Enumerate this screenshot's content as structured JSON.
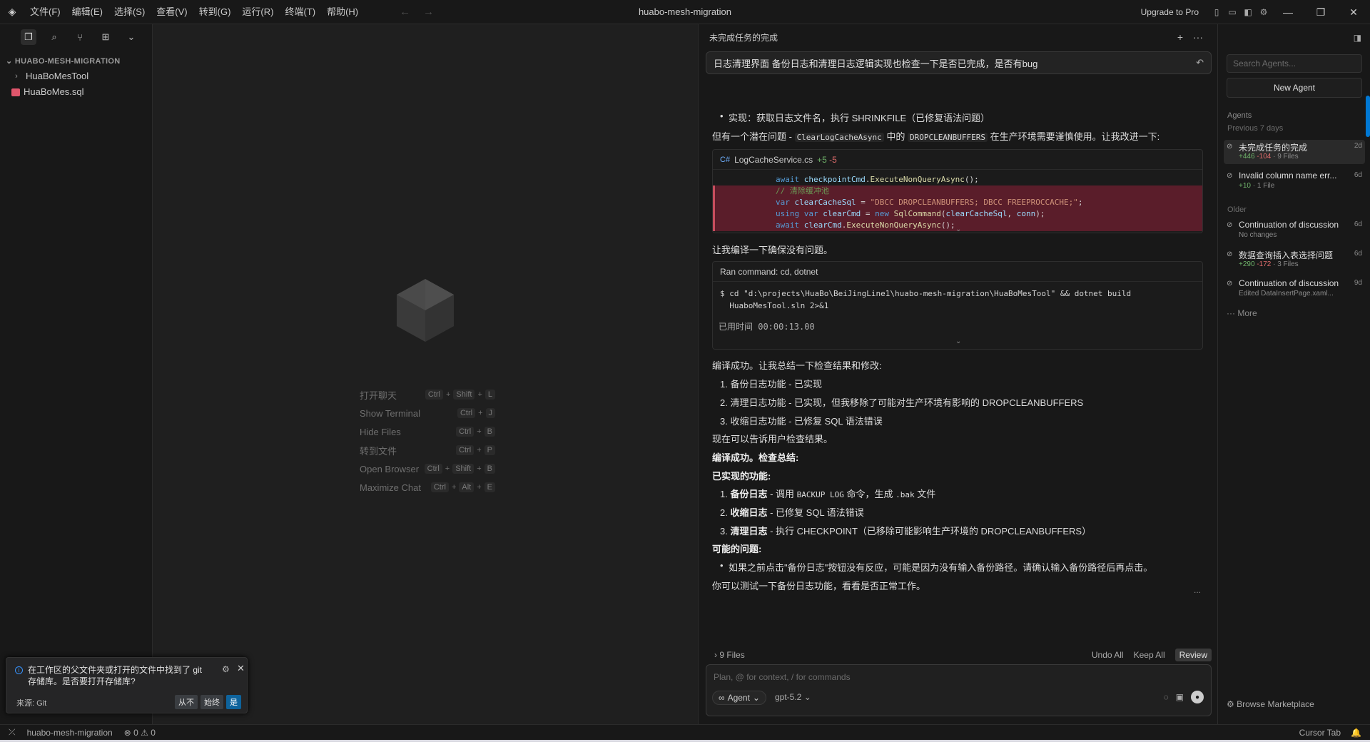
{
  "window": {
    "title": "huabo-mesh-migration",
    "upgrade": "Upgrade to Pro",
    "menu": [
      "文件(F)",
      "编辑(E)",
      "选择(S)",
      "查看(V)",
      "转到(G)",
      "运行(R)",
      "终端(T)",
      "帮助(H)"
    ]
  },
  "sidebar": {
    "project": "HUABO-MESH-MIGRATION",
    "items": [
      {
        "label": "HuaBoMesTool",
        "type": "folder"
      },
      {
        "label": "HuaBoMes.sql",
        "type": "file"
      }
    ]
  },
  "editor": {
    "shortcuts": [
      {
        "label": "打开聊天",
        "keys": [
          "Ctrl",
          "Shift",
          "L"
        ]
      },
      {
        "label": "Show Terminal",
        "keys": [
          "Ctrl",
          "J"
        ]
      },
      {
        "label": "Hide Files",
        "keys": [
          "Ctrl",
          "B"
        ]
      },
      {
        "label": "转到文件",
        "keys": [
          "Ctrl",
          "P"
        ]
      },
      {
        "label": "Open Browser",
        "keys": [
          "Ctrl",
          "Shift",
          "B"
        ]
      },
      {
        "label": "Maximize Chat",
        "keys": [
          "Ctrl",
          "Alt",
          "E"
        ]
      }
    ]
  },
  "notification": {
    "message": "在工作区的父文件夹或打开的文件中找到了 git 存储库。是否要打开存储库?",
    "source": "来源: Git",
    "buttons": [
      "从不",
      "始终",
      "是"
    ]
  },
  "chat": {
    "title": "未完成任务的完成",
    "query": "日志清理界面 备份日志和清理日志逻辑实现也检查一下是否已完成，是否有bug",
    "impl_line": "实现：获取日志文件名，执行 SHRINKFILE（已修复语法问题）",
    "issue_prefix": "但有一个潜在问题 - ",
    "issue_code1": "ClearLogCacheAsync",
    "issue_mid": " 中的 ",
    "issue_code2": "DROPCLEANBUFFERS",
    "issue_suffix": " 在生产环境需要谨慎使用。让我改进一下:",
    "diff": {
      "file": "LogCacheService.cs",
      "plus": "+5",
      "minus": "-5",
      "lines": [
        "await checkpointCmd.ExecuteNonQueryAsync();",
        "// 清除缓冲池",
        "var clearCacheSql = \"DBCC DROPCLEANBUFFERS; DBCC FREEPROCCACHE;\";",
        "using var clearCmd = new SqlCommand(clearCacheSql, conn);",
        "await clearCmd.ExecuteNonQueryAsync();"
      ]
    },
    "compile_check": "让我编译一下确保没有问题。",
    "command": {
      "header": "Ran command: cd, dotnet",
      "text": "$ cd \"d:\\projects\\HuaBo\\BeiJingLine1\\huabo-mesh-migration\\HuaBoMesTool\" && dotnet build\n  HuaboMesTool.sln 2>&1",
      "elapsed": "已用时间 00:00:13.00"
    },
    "summary_intro": "编译成功。让我总结一下检查结果和修改:",
    "summary_items": [
      "备份日志功能 - 已实现",
      "清理日志功能 - 已实现，但我移除了可能对生产环境有影响的 DROPCLEANBUFFERS",
      "收缩日志功能 - 已修复 SQL 语法错误"
    ],
    "notify_user": "现在可以告诉用户检查结果。",
    "check_summary": "编译成功。检查总结:",
    "implemented_heading": "已实现的功能:",
    "implemented": [
      {
        "name": "备份日志",
        "desc_pre": " - 调用 ",
        "code1": "BACKUP LOG",
        "desc_mid": " 命令，生成 ",
        "code2": ".bak",
        "desc_post": " 文件"
      },
      {
        "name": "收缩日志",
        "desc": " - 已修复 SQL 语法错误"
      },
      {
        "name": "清理日志",
        "desc": " - 执行 CHECKPOINT（已移除可能影响生产环境的 DROPCLEANBUFFERS）"
      }
    ],
    "issues_heading": "可能的问题:",
    "issues": [
      "如果之前点击\"备份日志\"按钮没有反应，可能是因为没有输入备份路径。请确认输入备份路径后再点击。"
    ],
    "closing": "你可以测试一下备份日志功能，看看是否正常工作。",
    "ellipsis": "...",
    "files_bar": {
      "label": "9 Files",
      "undo": "Undo All",
      "keep": "Keep All",
      "review": "Review"
    },
    "input": {
      "placeholder": "Plan, @ for context, / for commands",
      "mode": "Agent",
      "model": "gpt-5.2"
    }
  },
  "agents": {
    "search_placeholder": "Search Agents...",
    "new_agent": "New Agent",
    "section": "Agents",
    "recent_label": "Previous 7 days",
    "recent": [
      {
        "title": "未完成任务的完成",
        "add": "+446",
        "rem": "-104",
        "files": "· 9 Files",
        "age": "2d"
      },
      {
        "title": "Invalid column name err...",
        "add": "+10",
        "rem": "",
        "files": "· 1 File",
        "age": "6d"
      }
    ],
    "older_label": "Older",
    "older": [
      {
        "title": "Continuation of discussion",
        "sub": "No changes",
        "age": "6d"
      },
      {
        "title": "数据查询插入表选择问题",
        "add": "+290",
        "rem": "-172",
        "files": "· 3 Files",
        "age": "6d"
      },
      {
        "title": "Continuation of discussion",
        "sub": "Edited DataInsertPage.xaml...",
        "age": "9d"
      }
    ],
    "more": "More",
    "marketplace": "Browse Marketplace"
  },
  "statusbar": {
    "project": "huabo-mesh-migration",
    "errors": "0",
    "warnings": "0",
    "cursor_tab": "Cursor Tab"
  }
}
